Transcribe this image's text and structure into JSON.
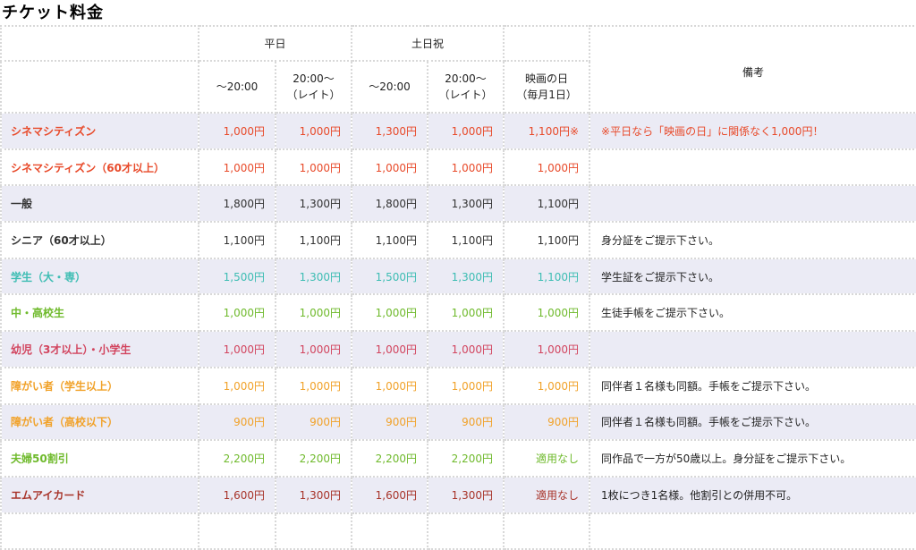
{
  "title": "チケット料金",
  "header": {
    "weekday": "平日",
    "holiday": "土日祝",
    "notes": "備考",
    "until20": "〜20:00",
    "late_line1": "20:00〜",
    "late_line2": "（レイト）",
    "until20_b": "〜20:00",
    "late_line1_b": "20:00〜",
    "late_line2_b": "（レイト）",
    "movie_day_line1": "映画の日",
    "movie_day_line2": "（毎月1日）"
  },
  "colors": {
    "red": "#e84a2a",
    "dark": "#333333",
    "teal": "#3dbdb3",
    "green": "#6fba2c",
    "pink": "#d2455f",
    "orange": "#f1a22a",
    "maroon": "#a8342a"
  },
  "rows": [
    {
      "name": "シネマシティズン",
      "color": "red",
      "values": [
        "1,000円",
        "1,000円",
        "1,300円",
        "1,000円",
        "1,100円※"
      ],
      "note": "※平日なら「映画の日」に関係なく1,000円！",
      "note_color": "red"
    },
    {
      "name": "シネマシティズン（60才以上）",
      "color": "red",
      "values": [
        "1,000円",
        "1,000円",
        "1,000円",
        "1,000円",
        "1,000円"
      ],
      "note": ""
    },
    {
      "name": "一般",
      "color": "dark",
      "values": [
        "1,800円",
        "1,300円",
        "1,800円",
        "1,300円",
        "1,100円"
      ],
      "note": ""
    },
    {
      "name": "シニア（60才以上）",
      "color": "dark",
      "values": [
        "1,100円",
        "1,100円",
        "1,100円",
        "1,100円",
        "1,100円"
      ],
      "note": "身分証をご提示下さい。"
    },
    {
      "name": "学生（大・専）",
      "color": "teal",
      "values": [
        "1,500円",
        "1,300円",
        "1,500円",
        "1,300円",
        "1,100円"
      ],
      "note": "学生証をご提示下さい。"
    },
    {
      "name": "中・高校生",
      "color": "green",
      "values": [
        "1,000円",
        "1,000円",
        "1,000円",
        "1,000円",
        "1,000円"
      ],
      "note": "生徒手帳をご提示下さい。"
    },
    {
      "name": "幼児（3才以上）・小学生",
      "color": "pink",
      "values": [
        "1,000円",
        "1,000円",
        "1,000円",
        "1,000円",
        "1,000円"
      ],
      "note": ""
    },
    {
      "name": "障がい者（学生以上）",
      "color": "orange",
      "values": [
        "1,000円",
        "1,000円",
        "1,000円",
        "1,000円",
        "1,000円"
      ],
      "note": "同伴者１名様も同額。手帳をご提示下さい。"
    },
    {
      "name": "障がい者（高校以下）",
      "color": "orange",
      "values": [
        "900円",
        "900円",
        "900円",
        "900円",
        "900円"
      ],
      "note": "同伴者１名様も同額。手帳をご提示下さい。"
    },
    {
      "name": "夫婦50割引",
      "color": "green",
      "values": [
        "2,200円",
        "2,200円",
        "2,200円",
        "2,200円",
        "適用なし"
      ],
      "note": "同作品で一方が50歳以上。身分証をご提示下さい。"
    },
    {
      "name": "エムアイカード",
      "color": "maroon",
      "values": [
        "1,600円",
        "1,300円",
        "1,600円",
        "1,300円",
        "適用なし"
      ],
      "note": "1枚につき1名様。他割引との併用不可。"
    }
  ]
}
